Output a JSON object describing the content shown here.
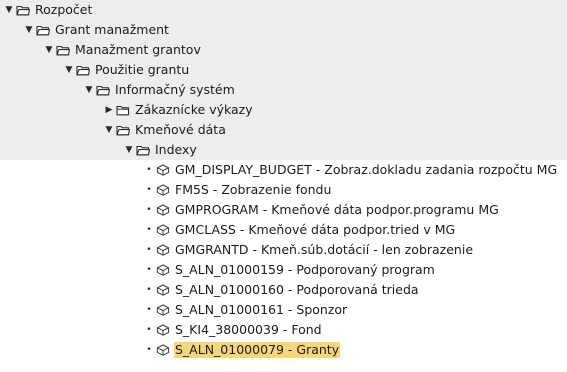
{
  "colors": {
    "row_dark": "#ededed",
    "row_light": "#ffffff",
    "selected_highlight": "#f7d57a",
    "folder_stroke": "#2b2b2b",
    "tcode_stroke": "#3a3a3a"
  },
  "icons": {
    "expanded": "expanded-triangle-icon",
    "collapsed": "collapsed-triangle-icon",
    "leaf_bullet": "bullet-icon",
    "folder_open": "folder-open-icon",
    "folder_closed": "folder-closed-icon",
    "transaction": "transaction-cube-icon"
  },
  "tree": [
    {
      "label": "Rozpočet",
      "level": 0,
      "kind": "folder",
      "state": "expanded"
    },
    {
      "label": "Grant manažment",
      "level": 1,
      "kind": "folder",
      "state": "expanded"
    },
    {
      "label": "Manažment grantov",
      "level": 2,
      "kind": "folder",
      "state": "expanded"
    },
    {
      "label": "Použitie grantu",
      "level": 3,
      "kind": "folder",
      "state": "expanded"
    },
    {
      "label": "Informačný systém",
      "level": 4,
      "kind": "folder",
      "state": "expanded"
    },
    {
      "label": "Zákaznícke výkazy",
      "level": 5,
      "kind": "folder",
      "state": "collapsed"
    },
    {
      "label": "Kmeňové dáta",
      "level": 5,
      "kind": "folder",
      "state": "expanded"
    },
    {
      "label": "Indexy",
      "level": 6,
      "kind": "folder",
      "state": "expanded"
    },
    {
      "label": "GM_DISPLAY_BUDGET - Zobraz.dokladu zadania rozpočtu MG",
      "level": 7,
      "kind": "transaction"
    },
    {
      "label": "FM5S - Zobrazenie fondu",
      "level": 7,
      "kind": "transaction"
    },
    {
      "label": "GMPROGRAM - Kmeňové dáta podpor.programu MG",
      "level": 7,
      "kind": "transaction"
    },
    {
      "label": "GMCLASS - Kmeňové dáta podpor.tried v MG",
      "level": 7,
      "kind": "transaction"
    },
    {
      "label": "GMGRANTD - Kmeň.súb.dotácií - len zobrazenie",
      "level": 7,
      "kind": "transaction"
    },
    {
      "label": "S_ALN_01000159 - Podporovaný program",
      "level": 7,
      "kind": "transaction"
    },
    {
      "label": "S_ALN_01000160 - Podporovaná trieda",
      "level": 7,
      "kind": "transaction"
    },
    {
      "label": "S_ALN_01000161 - Sponzor",
      "level": 7,
      "kind": "transaction"
    },
    {
      "label": "S_KI4_38000039 - Fond",
      "level": 7,
      "kind": "transaction"
    },
    {
      "label": "S_ALN_01000079 - Granty",
      "level": 7,
      "kind": "transaction",
      "selected": true
    }
  ]
}
